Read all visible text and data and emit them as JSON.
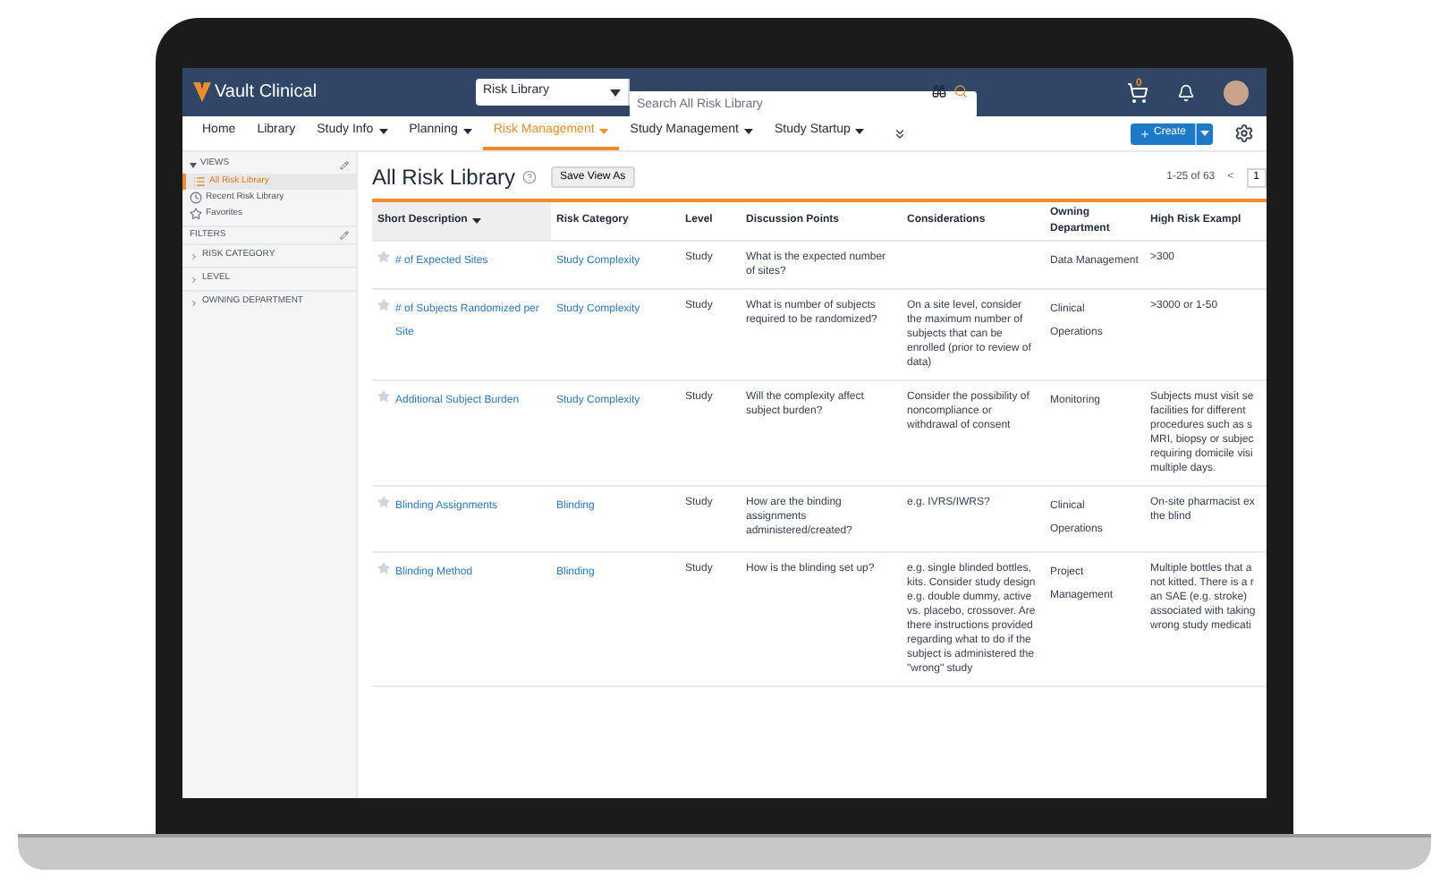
{
  "app": {
    "logo": "Vault Clinical",
    "search_scope": "Risk Library",
    "search": {
      "placeholder": "Search All Risk Library"
    },
    "cart_count": "0"
  },
  "nav": [
    {
      "label": "Home",
      "dropdown": false,
      "selected": false
    },
    {
      "label": "Library",
      "dropdown": false,
      "selected": false
    },
    {
      "label": "Study Info",
      "dropdown": true,
      "selected": false
    },
    {
      "label": "Planning",
      "dropdown": true,
      "selected": false
    },
    {
      "label": "Risk Management",
      "dropdown": true,
      "selected": true
    },
    {
      "label": "Study Management",
      "dropdown": true,
      "selected": false
    },
    {
      "label": "Study Startup",
      "dropdown": true,
      "selected": false
    }
  ],
  "create_button": "Create",
  "sidebar": {
    "views_title": "VIEWS",
    "views": [
      {
        "label": "All Risk Library",
        "kind": "list",
        "selected": true
      },
      {
        "label": "Recent Risk Library",
        "kind": "recent",
        "selected": false
      },
      {
        "label": "Favorites",
        "kind": "favorite",
        "selected": false
      }
    ],
    "filters_title": "FILTERS",
    "filters": [
      "RISK CATEGORY",
      "LEVEL",
      "OWNING DEPARTMENT"
    ]
  },
  "page": {
    "title": "All Risk Library",
    "save_view": "Save View As",
    "pagination": "1-25 of 63",
    "prev": "<",
    "page": "1"
  },
  "table": {
    "columns": [
      {
        "label": "Short Description",
        "sorted": true
      },
      {
        "label": "Risk Category",
        "sorted": false
      },
      {
        "label": "Level",
        "sorted": false
      },
      {
        "label": "Discussion Points",
        "sorted": false
      },
      {
        "label": "Considerations",
        "sorted": false
      },
      {
        "label": "Owning Department",
        "sorted": false
      },
      {
        "label": "High Risk Exampl",
        "sorted": false
      }
    ],
    "rows": [
      {
        "cells": [
          "# of Expected Sites",
          "Study Complexity",
          "Study",
          "What is the expected number of sites?",
          "",
          "Data Management",
          ">300"
        ]
      },
      {
        "cells": [
          "# of Subjects Randomized per Site",
          "Study Complexity",
          "Study",
          "What is number of subjects required to be randomized?",
          "On a site level, consider the maximum number of subjects that can be enrolled (prior to review of data)",
          "Clinical Operations",
          ">3000 or 1-50"
        ]
      },
      {
        "cells": [
          "Additional Subject Burden",
          "Study Complexity",
          "Study",
          "Will the complexity affect subject burden?",
          "Consider the possibility of noncompliance or withdrawal of consent",
          "Monitoring",
          "Subjects must visit se facilities for different procedures such as s MRI, biopsy or subjec requiring domicile visi multiple days."
        ]
      },
      {
        "cells": [
          "Blinding Assignments",
          "Blinding",
          "Study",
          "How are the binding assignments administered/created?",
          "e.g. IVRS/IWRS?",
          "Clinical Operations",
          "On-site pharmacist ex the blind"
        ]
      },
      {
        "cells": [
          "Blinding Method",
          "Blinding",
          "Study",
          "How is the blinding set up?",
          "e.g. single blinded bottles, kits. Consider study design e.g. double dummy, active vs. placebo, crossover. Are there instructions provided regarding what to do if the subject is administered the \"wrong\" study",
          "Project Management",
          "Multiple bottles that a not kitted. There is a r an SAE (e.g. stroke) associated with taking wrong study medicati"
        ]
      }
    ]
  }
}
